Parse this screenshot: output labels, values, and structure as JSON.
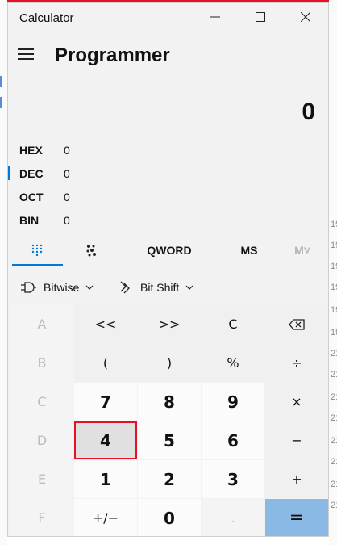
{
  "window": {
    "app_title": "Calculator",
    "mode_title": "Programmer"
  },
  "display": {
    "value": "0"
  },
  "radix": [
    {
      "label": "HEX",
      "value": "0"
    },
    {
      "label": "DEC",
      "value": "0"
    },
    {
      "label": "OCT",
      "value": "0"
    },
    {
      "label": "BIN",
      "value": "0"
    }
  ],
  "tabs": {
    "word_size": "QWORD",
    "memory_store": "MS",
    "memory_recall": "M˅"
  },
  "ops": {
    "bitwise": "Bitwise",
    "bit_shift": "Bit Shift"
  },
  "keys": {
    "row1": [
      "A",
      "<<",
      ">>",
      "C",
      "⌫"
    ],
    "row2": [
      "B",
      "(",
      ")",
      "%",
      "÷"
    ],
    "row3": [
      "C",
      "7",
      "8",
      "9",
      "×"
    ],
    "row4": [
      "D",
      "4",
      "5",
      "6",
      "−"
    ],
    "row5": [
      "E",
      "1",
      "2",
      "3",
      "+"
    ],
    "row6": [
      "F",
      "+/−",
      "0",
      ".",
      "="
    ]
  },
  "background_window": {
    "numbers": [
      "19",
      "19",
      "19",
      "19",
      "19",
      "19",
      "21",
      "21",
      "21",
      "21",
      "21",
      "21",
      "21",
      "21"
    ]
  },
  "colors": {
    "accent": "#0078d7",
    "equals": "#8bb9e6",
    "highlight_border": "#e81123"
  }
}
